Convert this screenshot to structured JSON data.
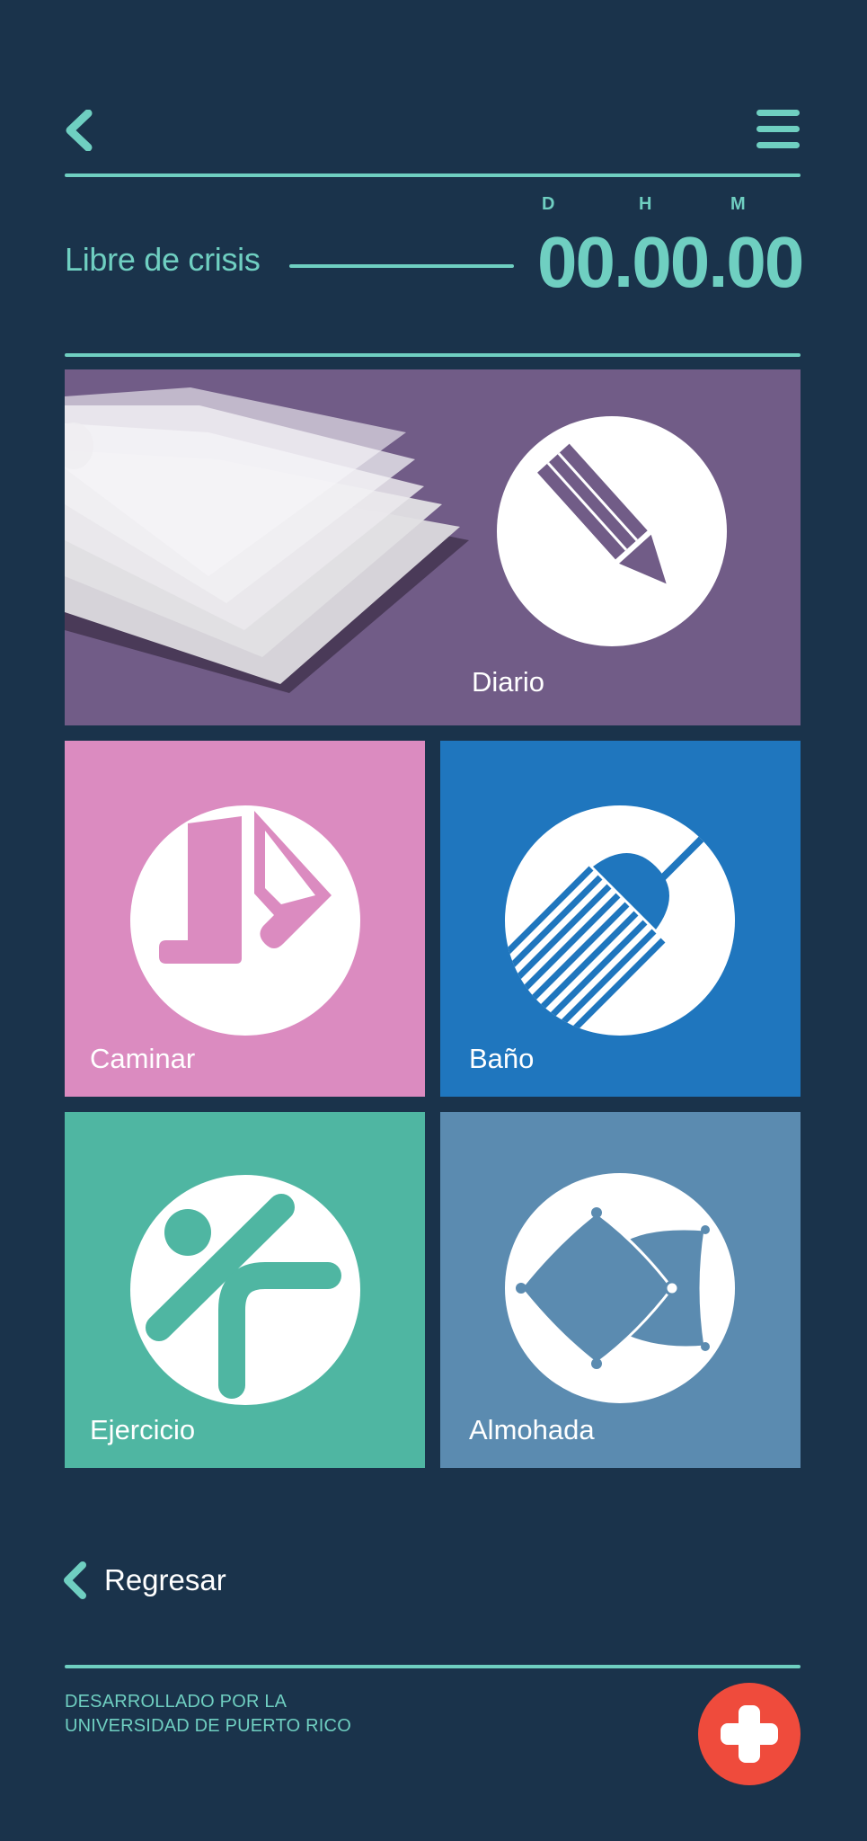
{
  "header": {
    "back_icon": "chevron-left-icon",
    "menu_icon": "hamburger-menu-icon"
  },
  "timer": {
    "label": "Libre de crisis",
    "units": [
      "D",
      "H",
      "M"
    ],
    "value": "00.00.00"
  },
  "tiles": [
    {
      "id": "diario",
      "label": "Diario",
      "color": "#715c87",
      "icon": "pencil-icon"
    },
    {
      "id": "caminar",
      "label": "Caminar",
      "color": "#db8bc0",
      "icon": "boot-icon"
    },
    {
      "id": "bano",
      "label": "Baño",
      "color": "#1f76be",
      "icon": "shower-icon"
    },
    {
      "id": "ejercicio",
      "label": "Ejercicio",
      "color": "#4fb6a2",
      "icon": "exercise-icon"
    },
    {
      "id": "almohada",
      "label": "Almohada",
      "color": "#5b8bb0",
      "icon": "pillow-icon"
    }
  ],
  "nav": {
    "back_label": "Regresar"
  },
  "footer": {
    "credit_line1": "DESARROLLADO POR LA",
    "credit_line2": "UNIVERSIDAD DE PUERTO RICO",
    "emergency_icon": "plus-icon"
  },
  "colors": {
    "background": "#1a334b",
    "accent": "#6fcfc1",
    "emergency": "#ef4b3c"
  }
}
